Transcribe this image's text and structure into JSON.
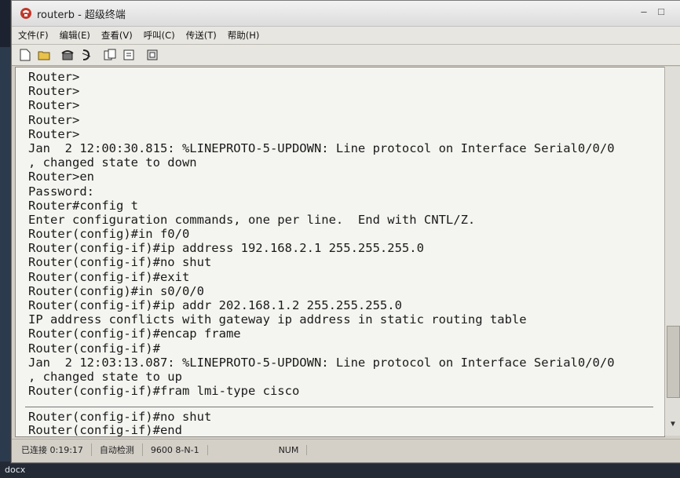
{
  "window": {
    "title": "routerb - 超级终端",
    "icon": "hyperterminal-phone-icon"
  },
  "menu": [
    "文件(F)",
    "编辑(E)",
    "查看(V)",
    "呼叫(C)",
    "传送(T)",
    "帮助(H)"
  ],
  "toolbar": {
    "icons": [
      "new-connection-icon",
      "open-icon",
      "dial-icon",
      "disconnect-icon",
      "send-icon",
      "receive-icon",
      "properties-icon"
    ]
  },
  "terminal": {
    "lines": [
      "Router>",
      "Router>",
      "Router>",
      "Router>",
      "Router>",
      "Jan  2 12:00:30.815: %LINEPROTO-5-UPDOWN: Line protocol on Interface Serial0/0/0",
      ", changed state to down",
      "Router>en",
      "Password:",
      "Router#config t",
      "Enter configuration commands, one per line.  End with CNTL/Z.",
      "Router(config)#in f0/0",
      "Router(config-if)#ip address 192.168.2.1 255.255.255.0",
      "Router(config-if)#no shut",
      "Router(config-if)#exit",
      "Router(config)#in s0/0/0",
      "Router(config-if)#ip addr 202.168.1.2 255.255.255.0",
      "IP address conflicts with gateway ip address in static routing table",
      "Router(config-if)#encap frame",
      "Router(config-if)#",
      "Jan  2 12:03:13.087: %LINEPROTO-5-UPDOWN: Line protocol on Interface Serial0/0/0",
      ", changed state to up",
      "Router(config-if)#fram lmi-type cisco"
    ],
    "input_lines": [
      "Router(config-if)#no shut",
      "Router(config-if)#end"
    ]
  },
  "statusbar": {
    "connected": "已连接 0:19:17",
    "detect": "自动检测",
    "port": "9600 8-N-1",
    "num": "NUM"
  },
  "desktop": {
    "taskbar_label": "docx"
  }
}
